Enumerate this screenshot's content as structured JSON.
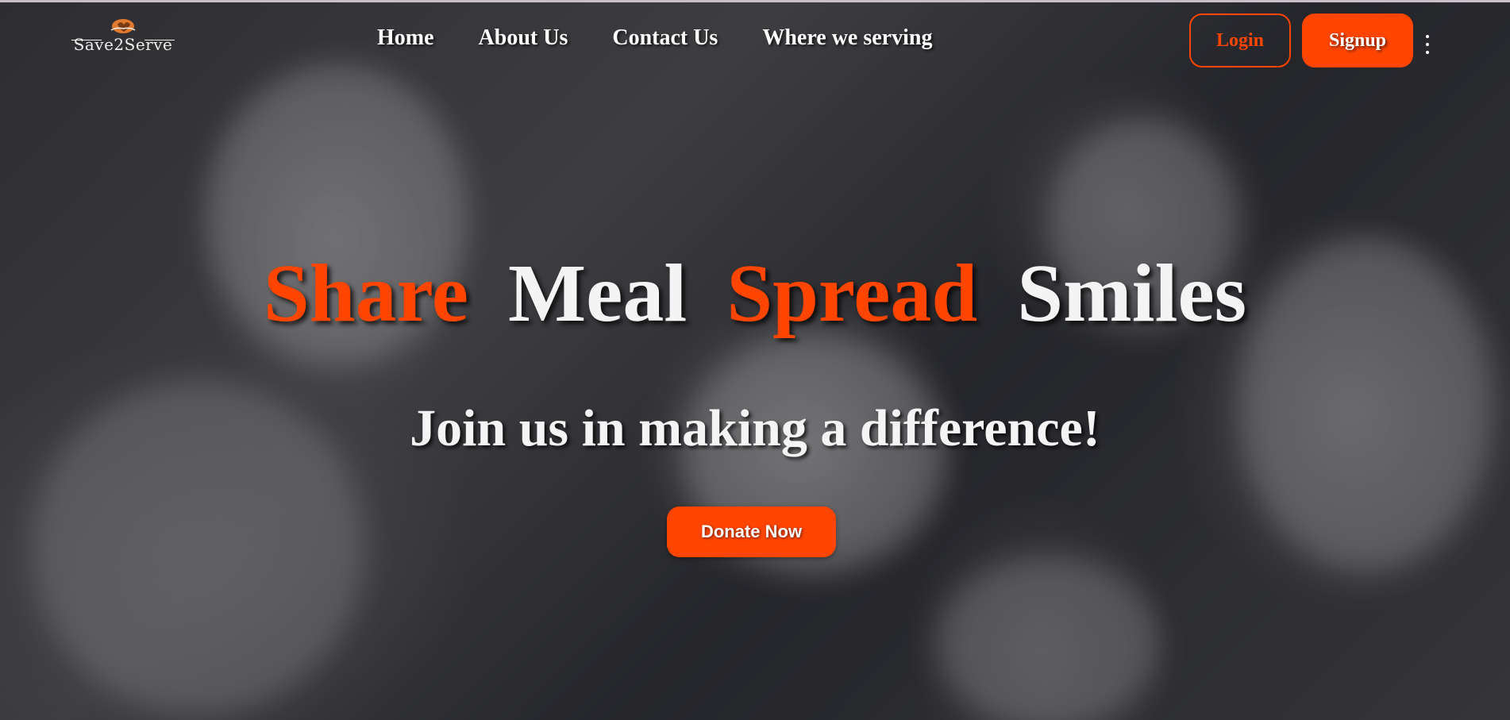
{
  "brand": {
    "name": "Save2Serve",
    "logo_icon": "hands-heart-icon",
    "accent_color": "#ff4500"
  },
  "nav": {
    "links": [
      {
        "label": "Home"
      },
      {
        "label": "About Us"
      },
      {
        "label": "Contact Us"
      },
      {
        "label": "Where we serving"
      }
    ],
    "login_label": "Login",
    "signup_label": "Signup",
    "more_icon": "kebab-menu-icon"
  },
  "hero": {
    "headline_words": [
      {
        "text": "Share",
        "accent": true
      },
      {
        "text": "Meal",
        "accent": false
      },
      {
        "text": "Spread",
        "accent": true
      },
      {
        "text": "Smiles",
        "accent": false
      }
    ],
    "subheadline": "Join us in making a difference!",
    "cta_label": "Donate Now"
  }
}
